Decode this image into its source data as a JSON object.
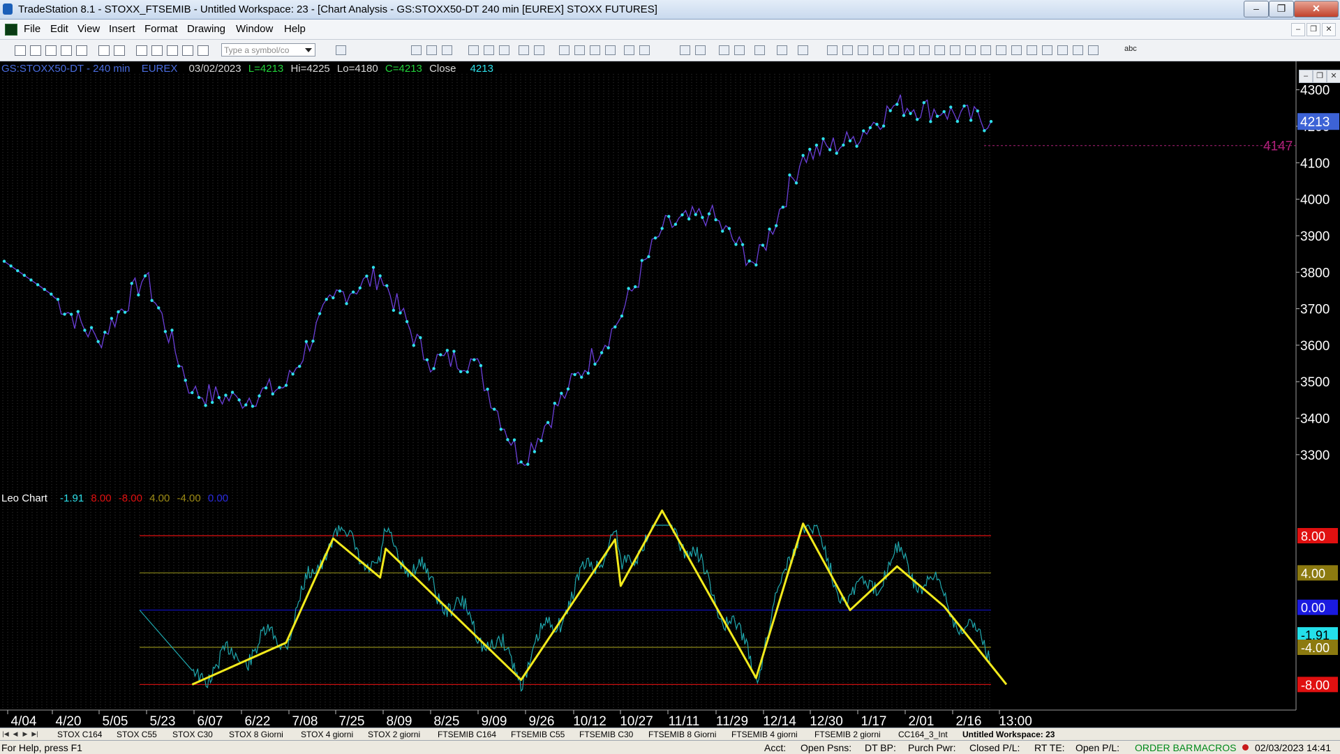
{
  "window": {
    "title": "TradeStation 8.1 - STOXX_FTSEMIB - Untitled Workspace:  23 - [Chart Analysis - GS:STOXX50-DT  240 min  [EUREX] STOXX FUTURES]"
  },
  "menu": {
    "items": [
      "File",
      "Edit",
      "View",
      "Insert",
      "Format",
      "Drawing",
      "Window",
      "Help"
    ]
  },
  "toolbar": {
    "symbol_placeholder": "Type a symbol/co",
    "text_tool": "abc"
  },
  "chart": {
    "header": {
      "symbol": "GS:STOXX50-DT - 240 min",
      "exchange": "EUREX",
      "date": "03/02/2023",
      "last": "L=4213",
      "high": "Hi=4225",
      "low": "Lo=4180",
      "close_val": "C=4213",
      "close_label": "Close",
      "close_num": "4213"
    },
    "indicator_header": {
      "name": "Leo Chart",
      "values": [
        "-1.91",
        "8.00",
        "-8.00",
        "4.00",
        "-4.00",
        "0.00"
      ]
    },
    "price_axis": [
      "4300",
      "4200",
      "4100",
      "4000",
      "3900",
      "3800",
      "3700",
      "3600",
      "3500",
      "3400",
      "3300"
    ],
    "last_price_tag": "4213",
    "ref_line_label": "4147",
    "indicator_axis": [
      "8.00",
      "4.00",
      "0.00",
      "-1.91",
      "-4.00",
      "-8.00"
    ],
    "date_axis": [
      "4/04",
      "4/20",
      "5/05",
      "5/23",
      "6/07",
      "6/22",
      "7/08",
      "7/25",
      "8/09",
      "8/25",
      "9/09",
      "9/26",
      "10/12",
      "10/27",
      "11/11",
      "11/29",
      "12/14",
      "12/30",
      "1/17",
      "2/01",
      "2/16",
      "13:00"
    ],
    "colors": {
      "price": "#2ee0ea",
      "price_line": "#6a3fd8",
      "oscillator": "#1fa7ad",
      "zigzag": "#f2ea1c",
      "band_outer": "#e01010",
      "band_mid": "#8c8a1a",
      "band_zero": "#1010c8",
      "grid": "#383838",
      "ref_line": "#b0207a"
    },
    "chart_data": {
      "type": "line",
      "title": "",
      "x": [
        "4/04",
        "4/20",
        "5/05",
        "5/23",
        "6/07",
        "6/22",
        "7/08",
        "7/25",
        "8/09",
        "8/25",
        "9/09",
        "9/26",
        "10/12",
        "10/27",
        "11/11",
        "11/29",
        "12/14",
        "12/30",
        "1/17",
        "2/01",
        "2/16",
        "3/02"
      ],
      "series": [
        {
          "values": [
            3830,
            3740,
            3610,
            3790,
            3470,
            3450,
            3490,
            3730,
            3790,
            3560,
            3560,
            3280,
            3480,
            3650,
            3920,
            3960,
            3820,
            4120,
            4160,
            4260,
            4240,
            4213
          ]
        }
      ],
      "ylim": [
        3250,
        4330
      ],
      "oscillator": {
        "ylim": [
          -10,
          11
        ],
        "levels": [
          8,
          4,
          0,
          -4,
          -8
        ],
        "current": -1.91,
        "zigzag": [
          {
            "x": "6/07",
            "y": -8.0
          },
          {
            "x": "7/08",
            "y": -3.5
          },
          {
            "x": "7/25",
            "y": 7.7
          },
          {
            "x": "8/09",
            "y": 3.5
          },
          {
            "x": "8/09",
            "y": 6.6
          },
          {
            "x": "9/26",
            "y": -7.5
          },
          {
            "x": "10/27",
            "y": 7.6
          },
          {
            "x": "10/27",
            "y": 2.6
          },
          {
            "x": "11/11",
            "y": 10.7
          },
          {
            "x": "12/14",
            "y": -7.3
          },
          {
            "x": "12/30",
            "y": 9.3
          },
          {
            "x": "1/17",
            "y": -0.0
          },
          {
            "x": "2/01",
            "y": 4.7
          },
          {
            "x": "2/16",
            "y": 0.4
          },
          {
            "x": "3/02",
            "y": -8.0
          }
        ]
      }
    }
  },
  "tabs": [
    "STOX C164",
    "STOX C55",
    "STOX  C30",
    "STOX  8 Giorni",
    "STOX 4 giorni",
    "STOX  2 giorni",
    "FTSEMIB C164",
    "FTSEMIB C55",
    "FTSEMIB C30",
    "FTSEMIB  8 Giorni",
    "FTSEMIB  4 giorni",
    "FTSEMIB  2 giorni",
    "CC164_3_Int",
    "Untitled Workspace:  23"
  ],
  "status": {
    "help": "For Help, press F1",
    "acct": "Acct:",
    "open_psns": "Open Psns:",
    "dt_bp": "DT BP:",
    "purch_pwr": "Purch Pwr:",
    "closed_pl": "Closed P/L:",
    "rt_te": "RT TE:",
    "open_pl": "Open P/L:",
    "order_bar": "ORDER BAR",
    "macros": "MACROS",
    "datetime": "02/03/2023 14:41"
  }
}
